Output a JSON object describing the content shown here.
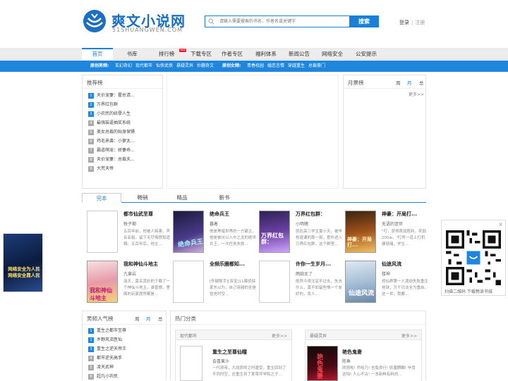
{
  "brand": {
    "name": "爽文小说网",
    "domain": "51SHUANGWEN.COM",
    "color": "#1a7fd6"
  },
  "search": {
    "placeholder": "请输入需要搜索的书名、作者名或关键字",
    "button": "搜索"
  },
  "user": {
    "login": "登录",
    "sep": "|",
    "register": "注册"
  },
  "nav": {
    "items": [
      "首页",
      "书库",
      "排行榜",
      "下载专区",
      "作者专区",
      "福利体系",
      "新闻公告",
      "网络安全",
      "公安提示"
    ],
    "hot_badge": "HOT"
  },
  "subnav": {
    "original_label": "原创男频:",
    "male": [
      "玄幻奇幻",
      "现代都市",
      "仙侠武侠",
      "悬疑灵异",
      "抄趣奇文"
    ],
    "female_label": "原创女频:",
    "female": [
      "青春校园",
      "婚恋言情",
      "穿越重生",
      "总裁豪门"
    ]
  },
  "recommend": {
    "title": "推荐榜",
    "items": [
      "天价宠妻：霍总请...",
      "万界红包群",
      "小农民的妖孽人生",
      "最强装逼抽奖系统",
      "美女总裁的贴身保镖",
      "鸡毛来袭：小萝太...",
      "霸道萌宠：娇妻乖...",
      "天价宠妻：总裁夫...",
      "大荒天帝"
    ]
  },
  "monthly": {
    "title": "月票榜",
    "tabs": [
      "周",
      "月",
      "总"
    ],
    "more": "更多>>"
  },
  "book_tabs": [
    "完本",
    "畅销",
    "精品",
    "新书"
  ],
  "books": [
    {
      "title": "都市仙武至尊",
      "author": "牧子期",
      "desc": "五百年前，他被人陷害，声名名裂，留下无尽悔恨和遗憾。五百年后，他主..."
    },
    {
      "title": "绝命兵王",
      "author": "暮着",
      "desc": "他是黑暗世界的一方霸主，他是被坑以入中之龙的绝世兵王，一次任务失败..."
    },
    {
      "title": "万界红包群：",
      "author": "小明猪",
      "desc": "就在高三学生夏小天，被学校退课的那一刻，意外进入万界红包群，这个群里..."
    },
    {
      "title": "神豪：开局打...",
      "author": "无语的翌世",
      "desc": "\"叮，获得首战胜利，奖励200w。\"叮咚一道上打机建就绪，学生..."
    },
    {
      "title": "我和神仙斗地主",
      "author": "九黄岩",
      "desc": "洛天，莫名其妙的下载了一个神仙斗地主，谁曾想，里面的玩家居然都是..."
    },
    {
      "title": "全频乐圈都知...",
      "author": "",
      "desc": "[怀疑联手][双宝]11曝侦探家东以为，自己穿越的全是冒充时空..."
    },
    {
      "title": "许你一生岁月...",
      "author": "雨田太了",
      "desc": "既然今夜注定不过去，失去什么，莫不如留些情一个友好的，发人..."
    },
    {
      "title": "仙途风流",
      "author": "楼神",
      "desc": "修仙界第一人渡劫失败重生地球，万千功法全为重启，这一世，我要..."
    }
  ],
  "promo": {
    "left_text": "网络安全为人民 网络安全靠人民",
    "qr_caption": "扫描二维码 下载畅读书城"
  },
  "male_rank": {
    "title": "男频人气榜",
    "tabs": [
      "周",
      "月",
      "总"
    ],
    "items": [
      "重生之都市至尊",
      "乡野风流医仙",
      "重生之逆天帝王",
      "都市逆天高手",
      "凌天武神",
      "超凡小农民"
    ]
  },
  "hot_cats": {
    "title": "热门分类",
    "cat1": "现代都市",
    "cat2": "悬疑灵异",
    "more": "更多>>",
    "book1": {
      "title": "重生之至尊仙瞳",
      "author": "会喜果汁",
      "desc": "一代邪帝，大战阴师之时遭受，重生回到了不同时空，还重生到了某草坪学院之子..."
    },
    "book2": {
      "title": "艳色鬼妻",
      "author": "陈鱼",
      "desc": "闹闹啦! 乔哈乃! 吉兔良行! 妖魔麒麟! 毕竟这怕! 人心不古! 一本新鲜有料的..."
    }
  }
}
